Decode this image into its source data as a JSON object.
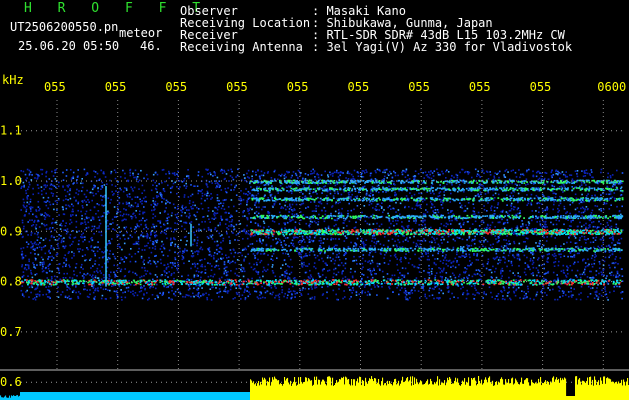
{
  "header": {
    "station_title": "H R O F F T",
    "filename": "UT2506200550.pn",
    "filename_suffix": "meteor",
    "datetime": "25.06.20 05:50",
    "count": "46.",
    "info_labels": [
      "Observer",
      "Receiving Location",
      "Receiver",
      "Receiving Antenna"
    ],
    "info_values": [
      ": Masaki Kano",
      ": Shibukawa, Gunma, Japan",
      ": RTL-SDR SDR# 43dB L15 103.2MHz CW",
      ": 3el Yagi(V) Az 330 for Vladivostok"
    ]
  },
  "chart_data": {
    "type": "heatmap",
    "title": "",
    "ylabel": "kHz",
    "x_tick_labels": [
      "055",
      "055",
      "055",
      "055",
      "055",
      "055",
      "055",
      "055",
      "055",
      "0600"
    ],
    "y_tick_labels": [
      "1.1",
      "1.0",
      "0.9",
      "0.8",
      "0.7",
      "0.6"
    ],
    "y_ticks": [
      1.1,
      1.0,
      0.9,
      0.8,
      0.7,
      0.6
    ],
    "ylim": [
      0.6,
      1.13
    ],
    "horizontal_bands_khz": [
      0.8,
      0.865,
      0.9,
      0.93,
      0.965,
      0.985,
      1.0
    ],
    "colors": {
      "background": "#000000",
      "noise": "#0a2ad0",
      "signal_hot": "#ff3030",
      "signal_warm": "#30ff60",
      "tick_text": "#ffff00",
      "histogram": "#ffff00",
      "histogram_low": "#00c8ff"
    }
  }
}
